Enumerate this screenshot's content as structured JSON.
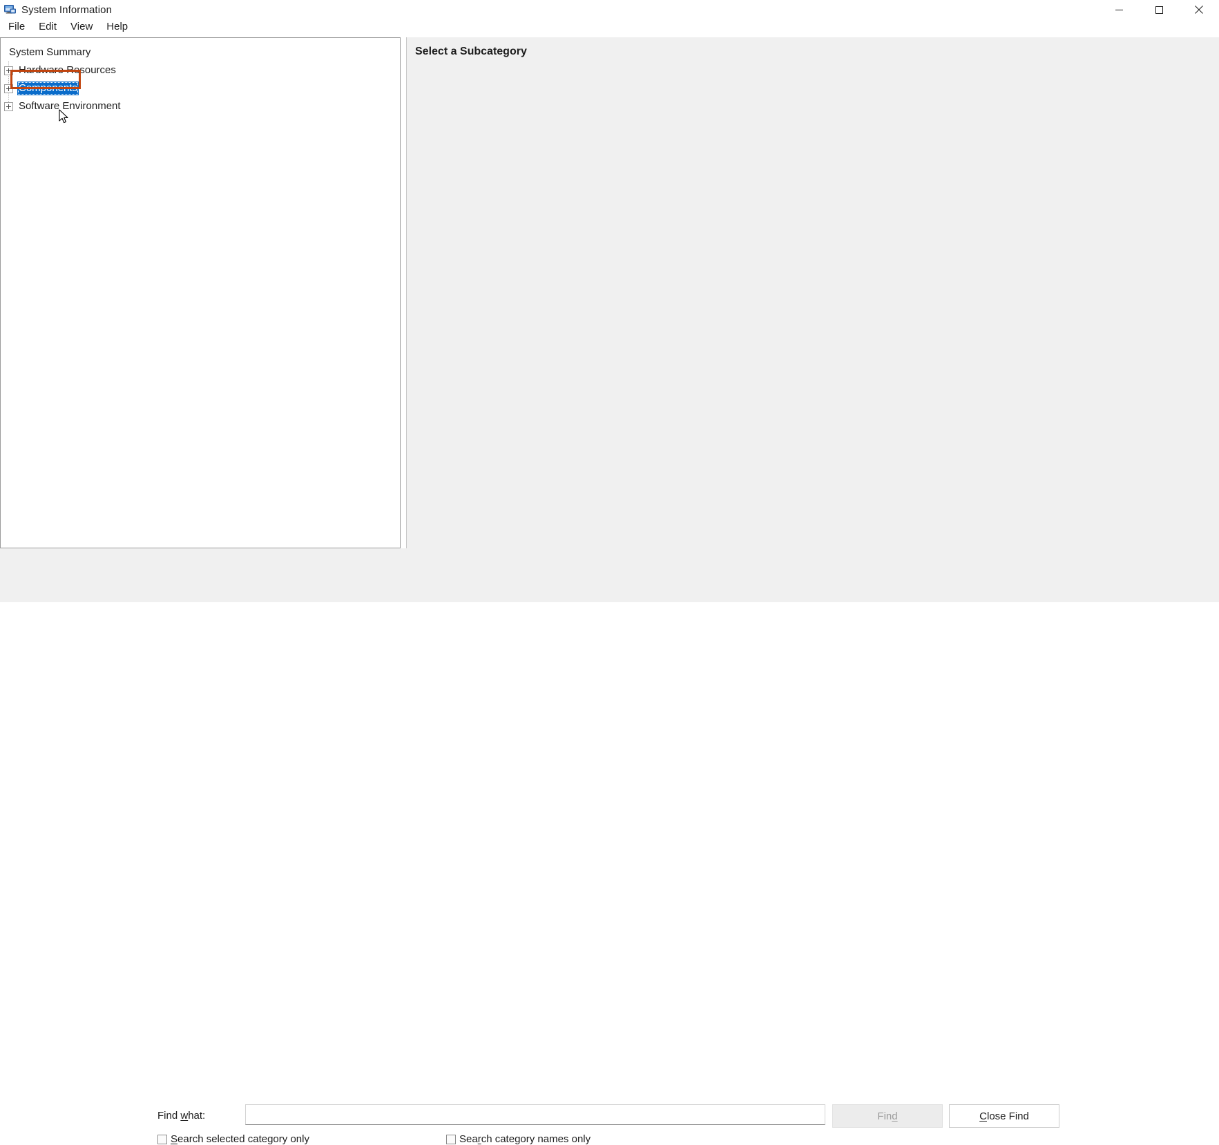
{
  "window": {
    "title": "System Information",
    "icon": "system-information-icon",
    "controls": {
      "minimize": "minimize-icon",
      "maximize": "maximize-icon",
      "close": "close-icon"
    }
  },
  "menubar": {
    "items": [
      {
        "label": "File"
      },
      {
        "label": "Edit"
      },
      {
        "label": "View"
      },
      {
        "label": "Help"
      }
    ]
  },
  "tree": {
    "items": [
      {
        "label": "System Summary",
        "expandable": false,
        "selected": false
      },
      {
        "label": "Hardware Resources",
        "expandable": true,
        "selected": false
      },
      {
        "label": "Components",
        "expandable": true,
        "selected": true
      },
      {
        "label": "Software Environment",
        "expandable": true,
        "selected": false
      }
    ]
  },
  "detail": {
    "header": "Select a Subcategory"
  },
  "find": {
    "label_pre": "Find ",
    "label_accel": "w",
    "label_post": "hat:",
    "input_value": "",
    "input_placeholder": "",
    "buttons": {
      "find": {
        "pre": "Fin",
        "accel": "d",
        "post": "",
        "enabled": false
      },
      "close": {
        "pre": "",
        "accel": "C",
        "post": "lose Find",
        "enabled": true
      }
    },
    "checkboxes": [
      {
        "pre": "",
        "accel": "S",
        "post": "earch selected category only",
        "checked": false
      },
      {
        "pre": "Sea",
        "accel": "r",
        "post": "ch category names only",
        "checked": false
      }
    ]
  },
  "colors": {
    "selection_blue": "#0a6cca",
    "annotation_red": "#c1440e",
    "panel_gray": "#f0f0f0",
    "window_white": "#ffffff"
  },
  "annotation": {
    "target": "Components",
    "cursor": "arrow-cursor"
  }
}
